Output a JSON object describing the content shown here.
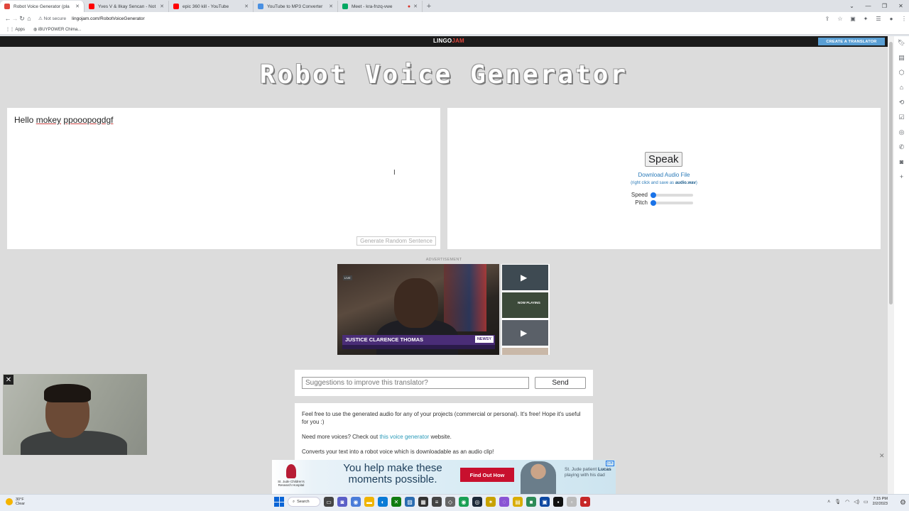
{
  "browser": {
    "tabs": [
      {
        "title": "Robot Voice Generator (pla",
        "color": "#e0463c",
        "active": true
      },
      {
        "title": "Yves V & Ilkay Sencan - Not So",
        "color": "#ff0000",
        "active": false
      },
      {
        "title": "epic 360 kill - YouTube",
        "color": "#ff0000",
        "active": false
      },
      {
        "title": "YouTube to MP3 Converter",
        "color": "#4a90e2",
        "active": false
      },
      {
        "title": "Meet - kra-fnzq-vwe",
        "color": "#00a862",
        "active": false
      }
    ],
    "new_tab": "+",
    "security": "Not secure",
    "url": "lingojam.com/RobotVoiceGenerator",
    "bookmarks": [
      "Apps",
      "iBUYPOWER Chima..."
    ]
  },
  "site": {
    "logo_main": "LINGO",
    "logo_accent": "JAM",
    "create_button": "CREATE A TRANSLATOR",
    "title": "Robot Voice Generator"
  },
  "input": {
    "word1": "Hello",
    "word2": "mokey",
    "word3": "ppooopogdgf",
    "random_button": "Generate Random Sentence"
  },
  "output": {
    "speak_button": "Speak",
    "download_link": "Download Audio File",
    "download_note_prefix": "(right click and save as ",
    "download_note_file": "audio.wav",
    "download_note_suffix": ")",
    "speed_label": "Speed",
    "speed_value": 0,
    "pitch_label": "Pitch",
    "pitch_value": 0
  },
  "advert": {
    "label": "ADVERTISEMENT",
    "live_tag": "LIVE",
    "lower_third_name": "JUSTICE CLARENCE THOMAS",
    "network": "NEWSY",
    "now_playing": "NOW PLAYING"
  },
  "suggestions": {
    "placeholder": "Suggestions to improve this translator?",
    "send_button": "Send"
  },
  "info": {
    "p1": "Feel free to use the generated audio for any of your projects (commercial or personal). It's free! Hope it's useful for you :)",
    "p2_prefix": "Need more voices? Check out ",
    "p2_link": "this voice generator",
    "p2_suffix": " website.",
    "p3": "Converts your text into a robot voice which is downloadable as an audio clip!"
  },
  "bottom_ad": {
    "sponsor": "St. Jude Children's Research Hospital",
    "headline": "You help make these moments possible.",
    "cta": "Find Out How",
    "caption_prefix": "St. Jude patient ",
    "caption_name": "Lucas",
    "caption_suffix": " playing with his dad"
  },
  "taskbar": {
    "weather_temp": "30°F",
    "weather_desc": "Clear",
    "search": "Search",
    "time": "7:15 PM",
    "date": "2/2/2023"
  }
}
